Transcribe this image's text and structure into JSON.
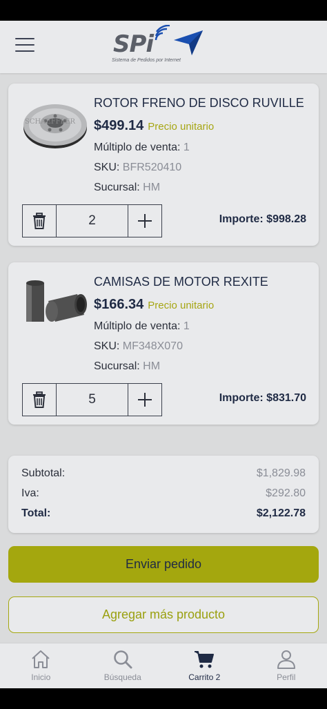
{
  "header": {
    "logo_text": "SPi",
    "logo_subtitle": "Sistema de Pedidos por Internet"
  },
  "labels": {
    "unit_price": "Precio unitario",
    "multiple": "Múltiplo de venta:",
    "sku": "SKU:",
    "branch": "Sucursal:"
  },
  "cart_items": [
    {
      "title": "ROTOR FRENO DE DISCO RUVILLE",
      "price": "$499.14",
      "multiple": "1",
      "sku": "BFR520410",
      "branch": "HM",
      "quantity": "2",
      "importe": "Importe: $998.28",
      "image": "brake-rotor-image",
      "image_watermark": "SCHAEFFLER"
    },
    {
      "title": "CAMISAS DE MOTOR REXITE",
      "price": "$166.34",
      "multiple": "1",
      "sku": "MF348X070",
      "branch": "HM",
      "quantity": "5",
      "importe": "Importe: $831.70",
      "image": "cylinder-sleeve-image"
    }
  ],
  "totals": {
    "subtotal_label": "Subtotal:",
    "subtotal": "$1,829.98",
    "iva_label": "Iva:",
    "iva": "$292.80",
    "total_label": "Total:",
    "total": "$2,122.78"
  },
  "actions": {
    "send": "Enviar pedido",
    "add_more": "Agregar más producto"
  },
  "nav": [
    {
      "label": "Inicio",
      "icon": "home-icon"
    },
    {
      "label": "Búsqueda",
      "icon": "search-icon"
    },
    {
      "label": "Carrito 2",
      "icon": "cart-icon",
      "active": true
    },
    {
      "label": "Perfil",
      "icon": "user-icon"
    }
  ],
  "colors": {
    "accent": "#a4a70e",
    "navy": "#1f2a44",
    "muted": "#8a8d96",
    "logo_blue": "#1a4fb0"
  }
}
